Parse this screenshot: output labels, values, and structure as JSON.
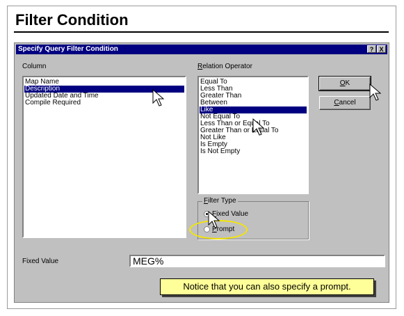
{
  "slide": {
    "title": "Filter Condition",
    "callout": "Notice that you can also specify a prompt."
  },
  "dialog": {
    "title": "Specify Query Filter Condition",
    "help_btn": "?",
    "close_btn": "X",
    "column_label": "Column",
    "columns": [
      {
        "label": "Map Name",
        "selected": false
      },
      {
        "label": "Description",
        "selected": true
      },
      {
        "label": "Updated Date and Time",
        "selected": false
      },
      {
        "label": "Compile Required",
        "selected": false
      }
    ],
    "relation_label_first": "R",
    "relation_label_rest": "elation Operator",
    "operators": [
      {
        "label": "Equal To",
        "selected": false
      },
      {
        "label": "Less Than",
        "selected": false
      },
      {
        "label": "Greater Than",
        "selected": false
      },
      {
        "label": "Between",
        "selected": false
      },
      {
        "label": "Like",
        "selected": true
      },
      {
        "label": "Not Equal To",
        "selected": false
      },
      {
        "label": "Less Than or Equal To",
        "selected": false
      },
      {
        "label": "Greater Than or Equal To",
        "selected": false
      },
      {
        "label": "Not Like",
        "selected": false
      },
      {
        "label": "Is Empty",
        "selected": false
      },
      {
        "label": "Is Not Empty",
        "selected": false
      }
    ],
    "ok_first": "O",
    "ok_rest": "K",
    "cancel_first": "C",
    "cancel_rest": "ancel",
    "filter_type_first": "F",
    "filter_type_rest": "ilter Type",
    "fixed_first": "F",
    "fixed_rest": "ixed Value",
    "prompt_first": "P",
    "prompt_rest": "rompt",
    "filter_type_selected": "Fixed Value",
    "fixed_value_label": "Fixed Value",
    "fixed_value": "MEG%"
  },
  "colors": {
    "selection": "#000080",
    "highlight_ring": "#f5e600",
    "callout_bg": "#ffff99"
  }
}
